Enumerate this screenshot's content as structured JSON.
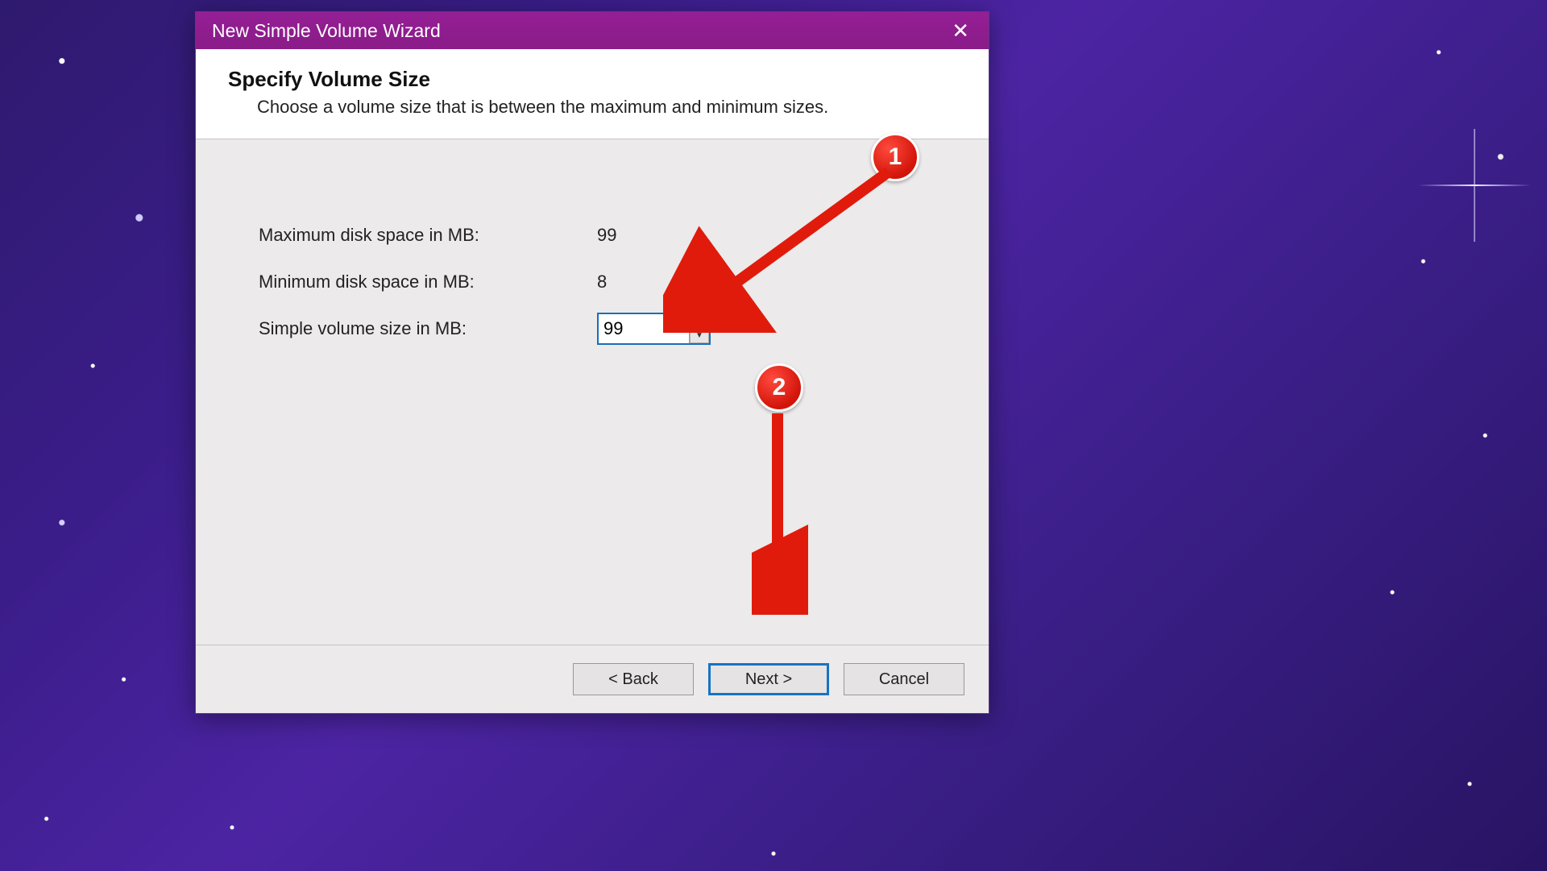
{
  "window": {
    "title": "New Simple Volume Wizard"
  },
  "header": {
    "title": "Specify Volume Size",
    "subtitle": "Choose a volume size that is between the maximum and minimum sizes."
  },
  "fields": {
    "max_label": "Maximum disk space in MB:",
    "max_value": "99",
    "min_label": "Minimum disk space in MB:",
    "min_value": "8",
    "size_label": "Simple volume size in MB:",
    "size_value": "99"
  },
  "buttons": {
    "back": "< Back",
    "next": "Next >",
    "cancel": "Cancel"
  },
  "annotations": {
    "badge1": "1",
    "badge2": "2"
  },
  "colors": {
    "titlebar": "#8b1f89",
    "accent": "#1674c2",
    "annotation": "#e01b0c"
  }
}
